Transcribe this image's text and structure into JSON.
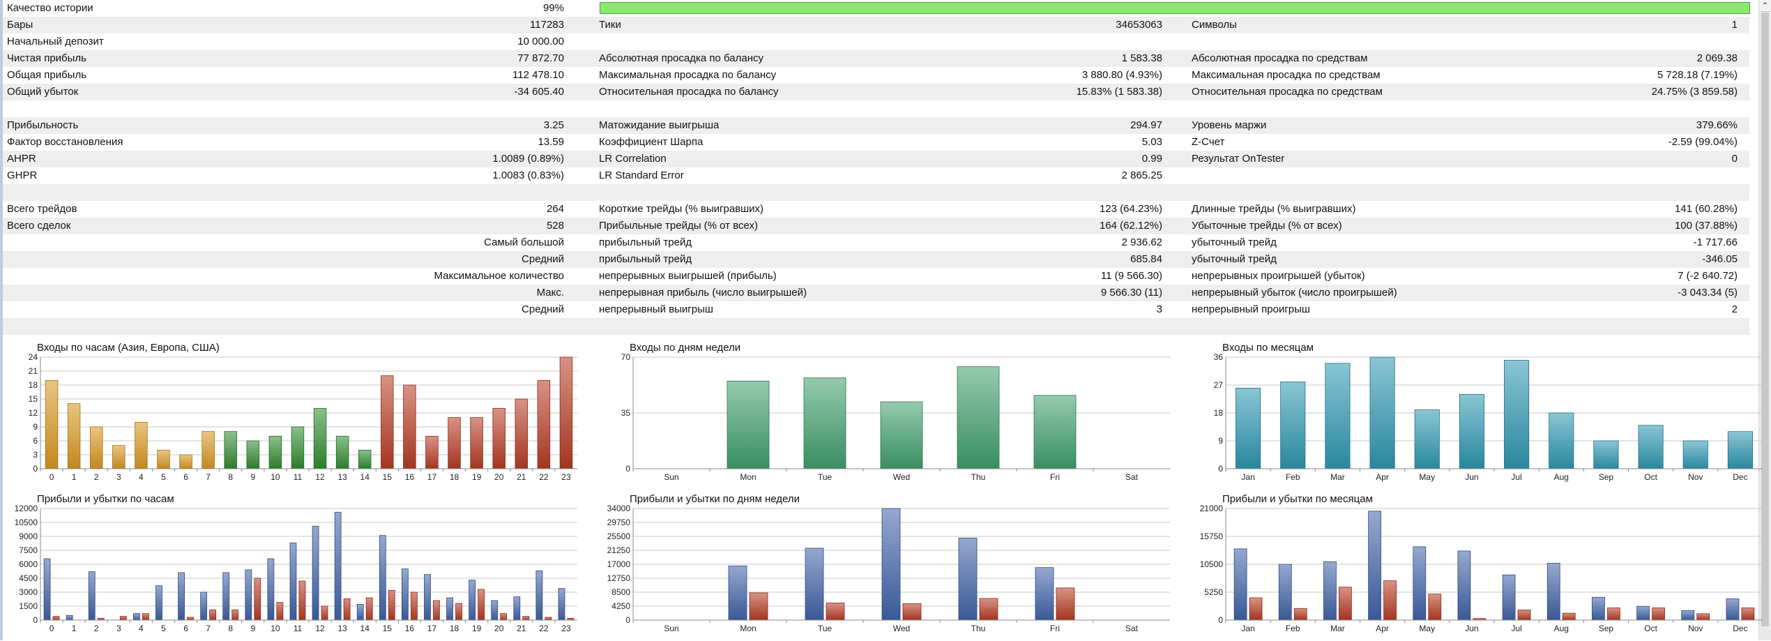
{
  "stats": {
    "quality_label": "Качество истории",
    "quality_value": "99%",
    "quality_fraction": 0.99,
    "rows": [
      {
        "shade": true,
        "l1": "Бары",
        "v1": "117283",
        "l2": "Тики",
        "v2": "34653063",
        "l3": "Символы",
        "v3": "1"
      },
      {
        "shade": false,
        "l1": "Начальный депозит",
        "v1": "10 000.00",
        "l2": "",
        "v2": "",
        "l3": "",
        "v3": ""
      },
      {
        "shade": true,
        "l1": "Чистая прибыль",
        "v1": "77 872.70",
        "l2": "Абсолютная просадка по балансу",
        "v2": "1 583.38",
        "l3": "Абсолютная просадка по средствам",
        "v3": "2 069.38"
      },
      {
        "shade": false,
        "l1": "Общая прибыль",
        "v1": "112 478.10",
        "l2": "Максимальная просадка по балансу",
        "v2": "3 880.80 (4.93%)",
        "l3": "Максимальная просадка по средствам",
        "v3": "5 728.18 (7.19%)"
      },
      {
        "shade": true,
        "l1": "Общий убыток",
        "v1": "-34 605.40",
        "l2": "Относительная просадка по балансу",
        "v2": "15.83% (1 583.38)",
        "l3": "Относительная просадка по средствам",
        "v3": "24.75% (3 859.58)"
      },
      {
        "shade": false,
        "l1": "",
        "v1": "",
        "l2": "",
        "v2": "",
        "l3": "",
        "v3": ""
      },
      {
        "shade": true,
        "l1": "Прибыльность",
        "v1": "3.25",
        "l2": "Матожидание выигрыша",
        "v2": "294.97",
        "l3": "Уровень маржи",
        "v3": "379.66%"
      },
      {
        "shade": false,
        "l1": "Фактор восстановления",
        "v1": "13.59",
        "l2": "Коэффициент Шарпа",
        "v2": "5.03",
        "l3": "Z-Счет",
        "v3": "-2.59 (99.04%)"
      },
      {
        "shade": true,
        "l1": "AHPR",
        "v1": "1.0089 (0.89%)",
        "l2": "LR Correlation",
        "v2": "0.99",
        "l3": "Результат OnTester",
        "v3": "0"
      },
      {
        "shade": false,
        "l1": "GHPR",
        "v1": "1.0083 (0.83%)",
        "l2": "LR Standard Error",
        "v2": "2 865.25",
        "l3": "",
        "v3": ""
      },
      {
        "shade": true,
        "l1": "",
        "v1": "",
        "l2": "",
        "v2": "",
        "l3": "",
        "v3": ""
      },
      {
        "shade": false,
        "l1": "Всего трейдов",
        "v1": "264",
        "l2": "Короткие трейды (% выигравших)",
        "v2": "123 (64.23%)",
        "l3": "Длинные трейды (% выигравших)",
        "v3": "141 (60.28%)"
      },
      {
        "shade": true,
        "l1": "Всего сделок",
        "v1": "528",
        "l2": "Прибыльные трейды (% от всех)",
        "v2": "164 (62.12%)",
        "l3": "Убыточные трейды (% от всех)",
        "v3": "100 (37.88%)"
      },
      {
        "shade": false,
        "lr": "Самый большой",
        "l2": "прибыльный трейд",
        "v2": "2 936.62",
        "l3": "убыточный трейд",
        "v3": "-1 717.66"
      },
      {
        "shade": true,
        "lr": "Средний",
        "l2": "прибыльный трейд",
        "v2": "685.84",
        "l3": "убыточный трейд",
        "v3": "-346.05"
      },
      {
        "shade": false,
        "lr": "Максимальное количество",
        "l2": "непрерывных выигрышей (прибыль)",
        "v2": "11 (9 566.30)",
        "l3": "непрерывных проигрышей (убыток)",
        "v3": "7 (-2 640.72)"
      },
      {
        "shade": true,
        "lr": "Макс.",
        "l2": "непрерывная прибыль (число выигрышей)",
        "v2": "9 566.30 (11)",
        "l3": "непрерывный убыток (число проигрышей)",
        "v3": "-3 043.34 (5)"
      },
      {
        "shade": false,
        "lr": "Средний",
        "l2": "непрерывный выигрыш",
        "v2": "3",
        "l3": "непрерывный проигрыш",
        "v3": "2"
      },
      {
        "shade": true,
        "l1": "",
        "v1": "",
        "l2": "",
        "v2": "",
        "l3": "",
        "v3": ""
      }
    ]
  },
  "colors": {
    "orange": "#d9961e",
    "green": "#2f8a2f",
    "red": "#b63a22",
    "blue": "#3f62a8",
    "teal_green": "#3f9e6c",
    "cyan": "#2c96b0",
    "grid": "#c9c9c9"
  },
  "chart_data": [
    {
      "type": "bar",
      "title": "Входы по часам (Азия, Европа, США)",
      "categories": [
        "0",
        "1",
        "2",
        "3",
        "4",
        "5",
        "6",
        "7",
        "8",
        "9",
        "10",
        "11",
        "12",
        "13",
        "14",
        "15",
        "16",
        "17",
        "18",
        "19",
        "20",
        "21",
        "22",
        "23"
      ],
      "series": [
        {
          "values": [
            19,
            14,
            9,
            5,
            10,
            4,
            3,
            8,
            8,
            6,
            7,
            9,
            13,
            7,
            4,
            20,
            18,
            7,
            11,
            11,
            13,
            15,
            19,
            24
          ]
        }
      ],
      "colors": [
        "orange",
        "orange",
        "orange",
        "orange",
        "orange",
        "orange",
        "orange",
        "orange",
        "green",
        "green",
        "green",
        "green",
        "green",
        "green",
        "green",
        "red",
        "red",
        "red",
        "red",
        "red",
        "red",
        "red",
        "red",
        "red"
      ],
      "yticks": [
        "0",
        "3",
        "6",
        "9",
        "12",
        "15",
        "18",
        "21",
        "24"
      ],
      "ylim": [
        0,
        24
      ]
    },
    {
      "type": "bar",
      "title": "Входы по дням недели",
      "categories": [
        "Sun",
        "Mon",
        "Tue",
        "Wed",
        "Thu",
        "Fri",
        "Sat"
      ],
      "series": [
        {
          "values": [
            0,
            55,
            57,
            42,
            64,
            46,
            0
          ]
        }
      ],
      "color": "teal_green",
      "yticks": [
        "0",
        "35",
        "70"
      ],
      "ylim": [
        0,
        70
      ]
    },
    {
      "type": "bar",
      "title": "Входы по месяцам",
      "categories": [
        "Jan",
        "Feb",
        "Mar",
        "Apr",
        "May",
        "Jun",
        "Jul",
        "Aug",
        "Sep",
        "Oct",
        "Nov",
        "Dec"
      ],
      "series": [
        {
          "values": [
            26,
            28,
            34,
            36,
            19,
            24,
            35,
            18,
            9,
            14,
            9,
            12
          ]
        }
      ],
      "color": "cyan",
      "yticks": [
        "0",
        "9",
        "18",
        "27",
        "36"
      ],
      "ylim": [
        0,
        36
      ]
    },
    {
      "type": "bar",
      "title": "Прибыли и убытки по часам",
      "categories": [
        "0",
        "1",
        "2",
        "3",
        "4",
        "5",
        "6",
        "7",
        "8",
        "9",
        "10",
        "11",
        "12",
        "13",
        "14",
        "15",
        "16",
        "17",
        "18",
        "19",
        "20",
        "21",
        "22",
        "23"
      ],
      "series": [
        {
          "values": [
            6600,
            500,
            5200,
            0,
            700,
            3700,
            5100,
            3000,
            5100,
            5400,
            6600,
            8300,
            10100,
            11600,
            1700,
            9100,
            5500,
            4900,
            2400,
            4300,
            2100,
            2500,
            5300,
            3400
          ]
        },
        {
          "values": [
            400,
            0,
            200,
            400,
            700,
            0,
            300,
            1100,
            1100,
            4500,
            1900,
            4200,
            1500,
            2300,
            2400,
            3200,
            3000,
            2100,
            1800,
            3300,
            700,
            400,
            300,
            200
          ]
        }
      ],
      "colors": [
        "blue",
        "red"
      ],
      "yticks": [
        "0",
        "1500",
        "3000",
        "4500",
        "6000",
        "7500",
        "9000",
        "10500",
        "12000"
      ],
      "ylim": [
        0,
        12000
      ]
    },
    {
      "type": "bar",
      "title": "Прибыли и убытки по дням недели",
      "categories": [
        "Sun",
        "Mon",
        "Tue",
        "Wed",
        "Thu",
        "Fri",
        "Sat"
      ],
      "series": [
        {
          "values": [
            0,
            16500,
            21900,
            34000,
            25000,
            16000,
            0
          ]
        },
        {
          "values": [
            0,
            8300,
            5200,
            5000,
            6600,
            9800,
            0
          ]
        }
      ],
      "colors": [
        "blue",
        "red"
      ],
      "yticks": [
        "0",
        "4250",
        "8500",
        "12750",
        "17000",
        "21250",
        "25500",
        "29750",
        "34000"
      ],
      "ylim": [
        0,
        34000
      ]
    },
    {
      "type": "bar",
      "title": "Прибыли и убытки по месяцам",
      "categories": [
        "Jan",
        "Feb",
        "Mar",
        "Apr",
        "May",
        "Jun",
        "Jul",
        "Aug",
        "Sep",
        "Oct",
        "Nov",
        "Dec"
      ],
      "series": [
        {
          "values": [
            13400,
            10500,
            11000,
            20500,
            13800,
            13000,
            8500,
            10700,
            4300,
            2600,
            1800,
            4000
          ]
        },
        {
          "values": [
            4200,
            2200,
            6200,
            7400,
            4900,
            300,
            1900,
            1300,
            2300,
            2300,
            1200,
            2300
          ]
        }
      ],
      "colors": [
        "blue",
        "red"
      ],
      "yticks": [
        "0",
        "5250",
        "10500",
        "15750",
        "21000"
      ],
      "ylim": [
        0,
        21000
      ]
    }
  ]
}
